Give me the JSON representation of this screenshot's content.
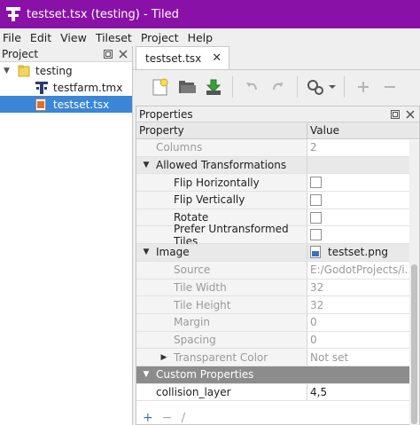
{
  "window": {
    "title": "testset.tsx (testing) - Tiled"
  },
  "menu": [
    "File",
    "Edit",
    "View",
    "Tileset",
    "Project",
    "Help"
  ],
  "project_panel": {
    "title": "Project",
    "items": [
      {
        "label": "testing",
        "type": "folder"
      },
      {
        "label": "testfarm.tmx",
        "type": "map"
      },
      {
        "label": "testset.tsx",
        "type": "tileset",
        "selected": true
      }
    ]
  },
  "tab": {
    "label": "testset.tsx"
  },
  "properties_panel": {
    "title": "Properties",
    "col_property": "Property",
    "col_value": "Value",
    "rows": [
      {
        "name": "Columns",
        "value": "2"
      },
      {
        "name": "Allowed Transformations",
        "value": ""
      },
      {
        "name": "Flip Horizontally",
        "value": ""
      },
      {
        "name": "Flip Vertically",
        "value": ""
      },
      {
        "name": "Rotate",
        "value": ""
      },
      {
        "name": "Prefer Untransformed Tiles",
        "value": ""
      },
      {
        "name": "Image",
        "value": "testset.png"
      },
      {
        "name": "Source",
        "value": "E:/GodotProjects/i..."
      },
      {
        "name": "Tile Width",
        "value": "32"
      },
      {
        "name": "Tile Height",
        "value": "32"
      },
      {
        "name": "Margin",
        "value": "0"
      },
      {
        "name": "Spacing",
        "value": "0"
      },
      {
        "name": "Transparent Color",
        "value": "Not set"
      },
      {
        "name": "Custom Properties",
        "value": ""
      },
      {
        "name": "collision_layer",
        "value": "4,5"
      }
    ]
  },
  "colors": {
    "titlebar": "#8a11a7",
    "selection": "#3b86d6",
    "custom_header": "#8c8c8c"
  }
}
